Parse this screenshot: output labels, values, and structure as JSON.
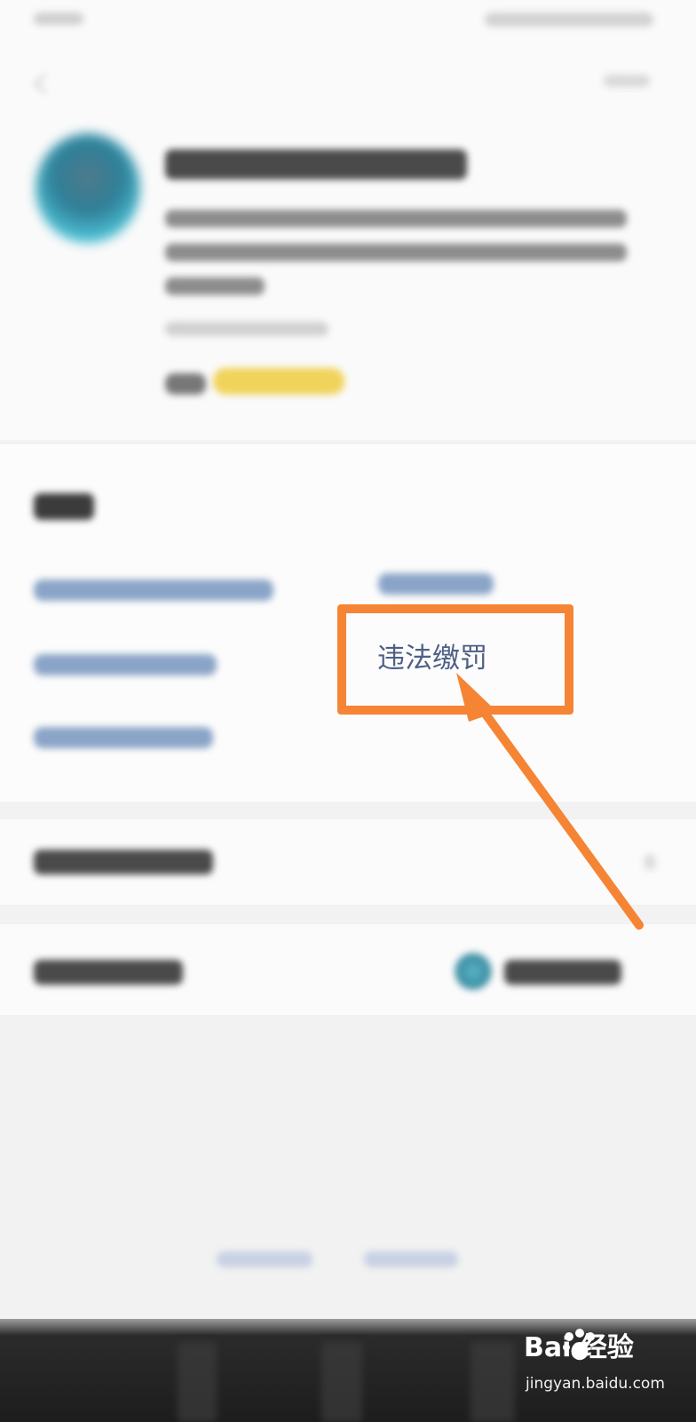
{
  "services": {
    "focused_item": "违法缴罚"
  },
  "watermark": {
    "brand_top": "Bai  经验",
    "brand_bottom": "jingyan.baidu.com"
  }
}
